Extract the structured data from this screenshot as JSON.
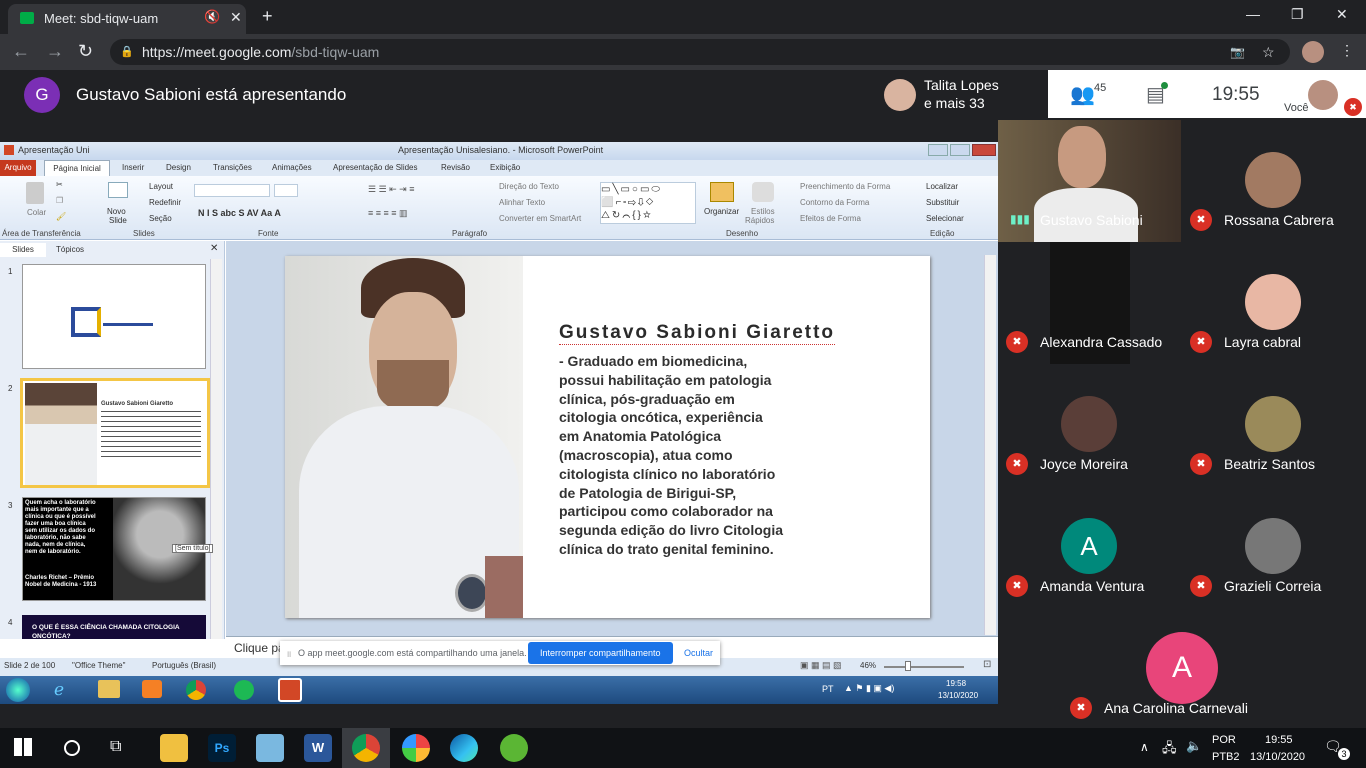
{
  "browser": {
    "tab_title": "Meet: sbd-tiqw-uam",
    "url_host": "https://meet.google.com",
    "url_path": "/sbd-tiqw-uam"
  },
  "meet": {
    "presenter_initial": "G",
    "presenter_text": "Gustavo Sabioni está apresentando",
    "top_user": "Talita Lopes",
    "top_others": "e mais 33",
    "participant_count": "45",
    "clock": "19:55",
    "self_label": "Você",
    "participants": [
      {
        "name": "Gustavo Sabioni"
      },
      {
        "name": "Rossana Cabrera"
      },
      {
        "name": "Alexandra Cassado"
      },
      {
        "name": "Layra cabral"
      },
      {
        "name": "Joyce Moreira"
      },
      {
        "name": "Beatriz Santos"
      },
      {
        "name": "Amanda Ventura",
        "initial": "A"
      },
      {
        "name": "Grazieli Correia"
      },
      {
        "name": "Ana Carolina Carnevali",
        "initial": "A"
      }
    ],
    "avatar_colors": {
      "amanda": "#00897b",
      "ana": "#e8457a"
    }
  },
  "ppt": {
    "window_left": "Apresentação Uni",
    "window_title": "Apresentação Unisalesiano. - Microsoft PowerPoint",
    "tabs": [
      "Arquivo",
      "Página Inicial",
      "Inserir",
      "Design",
      "Transições",
      "Animações",
      "Apresentação de Slides",
      "Revisão",
      "Exibição"
    ],
    "groups": [
      "Área de Transferência",
      "Slides",
      "Fonte",
      "Parágrafo",
      "Desenho",
      "Edição"
    ],
    "ribbon": {
      "colar": "Colar",
      "novo": "Novo",
      "slide": "Slide",
      "layout": "Layout",
      "redefinir": "Redefinir",
      "secao": "Seção",
      "direcao": "Direção do Texto",
      "alinhar": "Alinhar Texto",
      "converter": "Converter em SmartArt",
      "organizar": "Organizar",
      "estilos": "Estilos",
      "rapidos": "Rápidos",
      "preenchimento": "Preenchimento da Forma",
      "contorno": "Contorno da Forma",
      "efeitos": "Efeitos de Forma",
      "localizar": "Localizar",
      "substituir": "Substituir",
      "selecionar": "Selecionar"
    },
    "pane_tabs": [
      "Slides",
      "Tópicos"
    ],
    "slide_numbers": [
      "1",
      "2",
      "3",
      "4"
    ],
    "thumb3": "Quem acha o laboratório mais importante que a clínica ou que é possível fazer uma boa clínica sem utilizar os dados do laboratório, não sabe nada, nem de clínica, nem de laboratório.",
    "thumb3_author": "Charles Richet – Prêmio Nobel de Medicina - 1913",
    "thumb3_tooltip": "[Sem título]",
    "thumb4": "O QUE É ESSA CIÊNCIA CHAMADA CITOLOGIA ONCÓTICA?",
    "slide_title": "Gustavo Sabioni Giaretto",
    "slide_lines": [
      "- Graduado em biomedicina,",
      "possui habilitação em patologia",
      "clínica, pós-graduação em",
      "citologia oncótica, experiência",
      "em Anatomia Patológica",
      "(macroscopia), atua como",
      "citologista clínico no laboratório",
      "de Patologia de Birigui-SP,",
      "participou como colaborador  na",
      "segunda edição do livro Citologia",
      "clínica do trato genital feminino."
    ],
    "notes": "Clique pa",
    "status_slide": "Slide 2 de 100",
    "status_theme": "\"Office Theme\"",
    "status_lang": "Português (Brasil)",
    "zoom": "46%",
    "share_msg": "O app meet.google.com está compartilhando uma janela.",
    "stop_btn": "Interromper compartilhamento",
    "hide_btn": "Ocultar",
    "tray_lang": "PT",
    "tray_time": "19:58",
    "tray_date": "13/10/2020"
  },
  "os": {
    "lang1": "POR",
    "lang2": "PTB2",
    "time": "19:55",
    "date": "13/10/2020",
    "notif_count": "3"
  }
}
